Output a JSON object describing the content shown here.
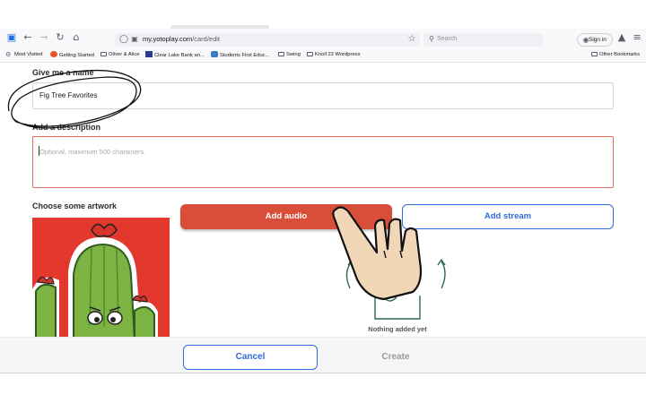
{
  "browser": {
    "url_host": "my.yotoplay.com",
    "url_path": "/card/edit",
    "search_placeholder": "Search",
    "sign_in_label": "Sign in",
    "bookmarks": [
      "Most Visited",
      "Getting Started",
      "Oliver & Alice",
      "Clear Lake Bank an...",
      "Students First Educ...",
      "Swing",
      "Knoll 22 Wordpress"
    ],
    "other_bookmarks": "Other Bookmarks"
  },
  "form": {
    "name_label": "Give me a name",
    "name_value": "Fig Tree Favorites",
    "description_label": "Add a description",
    "description_placeholder": "Optional, maximum 500 characters.",
    "artwork_label": "Choose some artwork"
  },
  "actions": {
    "add_audio": "Add audio",
    "add_stream": "Add stream",
    "empty_state": "Nothing added yet"
  },
  "footer": {
    "cancel": "Cancel",
    "create": "Create"
  },
  "colors": {
    "accent_red": "#d94e39",
    "accent_blue": "#2f6bd6",
    "artwork_bg": "#e2382e"
  }
}
